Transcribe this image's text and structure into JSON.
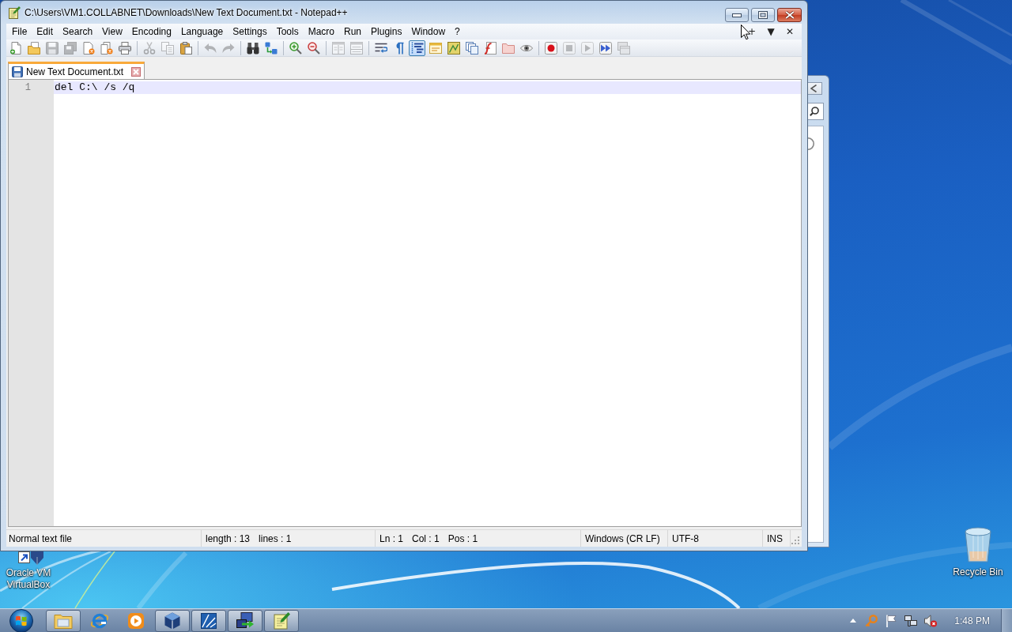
{
  "window": {
    "title": "C:\\Users\\VM1.COLLABNET\\Downloads\\New Text Document.txt - Notepad++",
    "menu": [
      "File",
      "Edit",
      "Search",
      "View",
      "Encoding",
      "Language",
      "Settings",
      "Tools",
      "Macro",
      "Run",
      "Plugins",
      "Window",
      "?"
    ],
    "menu_buttons": [
      "+",
      "▼",
      "✕"
    ],
    "toolbar": [
      {
        "buttons": [
          {
            "kind": "new",
            "disabled": false,
            "on": false
          },
          {
            "kind": "open",
            "disabled": false,
            "on": false
          },
          {
            "kind": "save",
            "disabled": true,
            "on": false
          },
          {
            "kind": "save-all",
            "disabled": true,
            "on": false
          },
          {
            "kind": "close",
            "disabled": false,
            "on": false
          },
          {
            "kind": "close-all",
            "disabled": false,
            "on": false
          },
          {
            "kind": "print",
            "disabled": false,
            "on": false
          }
        ]
      },
      {
        "buttons": [
          {
            "kind": "cut",
            "disabled": true,
            "on": false
          },
          {
            "kind": "copy",
            "disabled": true,
            "on": false
          },
          {
            "kind": "paste",
            "disabled": false,
            "on": false
          }
        ]
      },
      {
        "buttons": [
          {
            "kind": "undo",
            "disabled": true,
            "on": false
          },
          {
            "kind": "redo",
            "disabled": true,
            "on": false
          }
        ]
      },
      {
        "buttons": [
          {
            "kind": "find",
            "disabled": false,
            "on": false
          },
          {
            "kind": "replace",
            "disabled": false,
            "on": false
          }
        ]
      },
      {
        "buttons": [
          {
            "kind": "zoom-in",
            "disabled": false,
            "on": false
          },
          {
            "kind": "zoom-out",
            "disabled": false,
            "on": false
          }
        ]
      },
      {
        "buttons": [
          {
            "kind": "sync-vertical",
            "disabled": true,
            "on": false
          },
          {
            "kind": "sync-horizontal",
            "disabled": true,
            "on": false
          }
        ]
      },
      {
        "buttons": [
          {
            "kind": "word-wrap",
            "disabled": false,
            "on": false
          },
          {
            "kind": "all-chars",
            "disabled": false,
            "on": false
          },
          {
            "kind": "indent-guide",
            "disabled": false,
            "on": true
          },
          {
            "kind": "user-language",
            "disabled": false,
            "on": false
          },
          {
            "kind": "doc-map",
            "disabled": false,
            "on": false
          },
          {
            "kind": "doc-list",
            "disabled": false,
            "on": false
          },
          {
            "kind": "function-list",
            "disabled": false,
            "on": false
          },
          {
            "kind": "folder-workspace",
            "disabled": false,
            "on": false
          },
          {
            "kind": "monitor",
            "disabled": false,
            "on": false
          }
        ]
      },
      {
        "buttons": [
          {
            "kind": "record",
            "disabled": false,
            "on": false
          },
          {
            "kind": "stop",
            "disabled": true,
            "on": false
          },
          {
            "kind": "play",
            "disabled": true,
            "on": false
          },
          {
            "kind": "play-multiple",
            "disabled": false,
            "on": false
          },
          {
            "kind": "save-macro",
            "disabled": true,
            "on": false
          }
        ]
      }
    ],
    "tabs": [
      {
        "label": "New Text Document.txt",
        "selected": true
      }
    ],
    "editor": {
      "lines": [
        {
          "number": "1",
          "text": "del C:\\ /s /q",
          "current": true
        }
      ]
    },
    "status_bar": [
      {
        "texts": [
          "Normal text file"
        ]
      },
      {
        "texts": [
          "length : 13",
          "lines : 1"
        ]
      },
      {
        "texts": [
          "Ln : 1",
          "Col : 1",
          "Pos : 1"
        ]
      },
      {
        "texts": [
          "Windows (CR LF)"
        ]
      },
      {
        "texts": [
          "UTF-8"
        ]
      },
      {
        "texts": [
          "INS"
        ]
      }
    ]
  },
  "desktop": {
    "icons": [
      {
        "kind": "virtualbox",
        "label": "Oracle VM VirtualBox"
      },
      {
        "kind": "recycle-bin",
        "label": "Recycle Bin"
      }
    ]
  },
  "taskbar": {
    "buttons": [
      {
        "kind": "explorer",
        "running": true
      },
      {
        "kind": "browser",
        "running": false
      },
      {
        "kind": "media-player",
        "running": false
      },
      {
        "kind": "virtualbox",
        "running": true
      },
      {
        "kind": "tile-app",
        "running": true
      },
      {
        "kind": "network-app",
        "running": true
      },
      {
        "kind": "notepad",
        "running": true
      }
    ],
    "tray": [
      {
        "kind": "key"
      },
      {
        "kind": "flag"
      },
      {
        "kind": "network"
      },
      {
        "kind": "volume-muted"
      }
    ],
    "clock": "1:48 PM"
  }
}
